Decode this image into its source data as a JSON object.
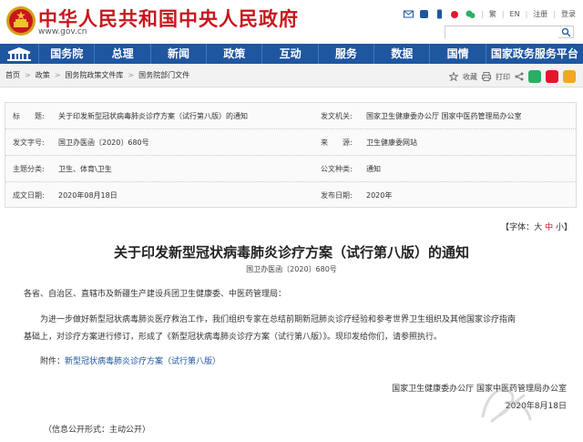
{
  "header": {
    "site_title": "中华人民共和国中央人民政府",
    "site_url": "www.gov.cn",
    "links": [
      "繁",
      "EN",
      "注册",
      "登录"
    ],
    "colors": {
      "brand_red": "#c8161d",
      "nav_blue": "#1e56a0"
    }
  },
  "nav": {
    "items": [
      "国务院",
      "总理",
      "新闻",
      "政策",
      "互动",
      "服务",
      "数据",
      "国情",
      "国家政务服务平台"
    ]
  },
  "breadcrumb": {
    "items": [
      "首页",
      "政策",
      "国务院政策文件库",
      "国务院部门文件"
    ],
    "tools": {
      "favorite": "收藏",
      "print": "打印"
    }
  },
  "meta": {
    "title_key": "标　　题:",
    "title_val": "关于印发新型冠状病毒肺炎诊疗方案（试行第八版）的通知",
    "issuer_key": "发文机关:",
    "issuer_val": "国家卫生健康委办公厅  国家中医药管理局办公室",
    "docno_key": "发文字号:",
    "docno_val": "国卫办医函〔2020〕680号",
    "source_key": "来　　源:",
    "source_val": "卫生健康委网站",
    "topic_key": "主题分类:",
    "topic_val": "卫生、体育\\卫生",
    "type_key": "公文种类:",
    "type_val": "通知",
    "date_key": "成文日期:",
    "date_val": "2020年08月18日",
    "pub_key": "发布日期:",
    "pub_val": "2020年"
  },
  "font_size": {
    "prefix": "【字体：",
    "big": "大",
    "mid": "中",
    "small": "小",
    "suffix": "】"
  },
  "article": {
    "title": "关于印发新型冠状病毒肺炎诊疗方案（试行第八版）的通知",
    "doc_no": "国卫办医函〔2020〕680号",
    "salutation": "各省、自治区、直辖市及新疆生产建设兵团卫生健康委、中医药管理局：",
    "body_line1": "为进一步做好新型冠状病毒肺炎医疗救治工作，我们组织专家在总结前期新冠肺炎诊疗经验和参考世界卫生组织及其他国家诊疗指南",
    "body_line2": "基础上，对诊疗方案进行修订，形成了《新型冠状病毒肺炎诊疗方案（试行第八版）》。现印发给你们，请参照执行。",
    "attach_label": "附件：",
    "attach_link": "新型冠状病毒肺炎诊疗方案（试行第八版）",
    "signature": "国家卫生健康委办公厅  国家中医药管理局办公室",
    "sign_date": "2020年8月18日",
    "footer": "（信息公开形式：主动公开）"
  }
}
